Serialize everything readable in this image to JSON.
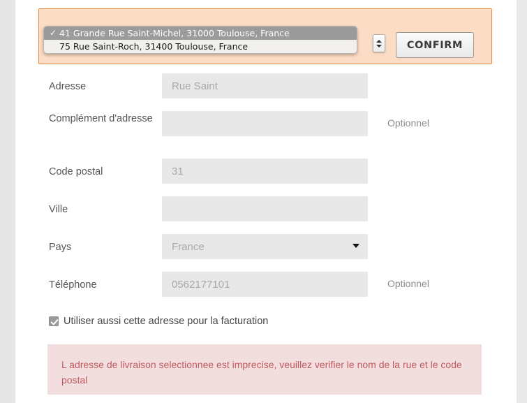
{
  "banner": {
    "select": {
      "name": "shipping-address-select",
      "expanded": true,
      "selected_index": 0,
      "options": [
        {
          "label": "41 Grande Rue Saint-Michel, 31000 Toulouse, France",
          "checkmark": "✓"
        },
        {
          "label": "75 Rue Saint-Roch, 31400 Toulouse, France",
          "checkmark": "✓"
        }
      ]
    },
    "confirm_label": "CONFIRM",
    "background_color": "#fcdcc4",
    "border_color": "#e08a4e"
  },
  "form": {
    "rows": [
      {
        "label": "Adresse",
        "value": "",
        "placeholder": "Rue Saint",
        "optional": "",
        "type": "text"
      },
      {
        "label": "Complément d'adresse",
        "value": "",
        "placeholder": "",
        "optional": "Optionnel",
        "type": "text"
      },
      {
        "label": "Code postal",
        "value": "",
        "placeholder": "31",
        "optional": "",
        "type": "text"
      },
      {
        "label": "Ville",
        "value": "",
        "placeholder": "",
        "optional": "",
        "type": "text"
      },
      {
        "label": "Pays",
        "value": "",
        "placeholder": "France",
        "optional": "",
        "type": "select"
      },
      {
        "label": "Téléphone",
        "value": "",
        "placeholder": "0562177101",
        "optional": "Optionnel",
        "type": "text"
      }
    ],
    "billing_checkbox": {
      "label": "Utiliser aussi cette adresse pour la facturation",
      "checked": true
    }
  },
  "error": {
    "text": "L adresse de livraison selectionnee est imprecise, veuillez verifier le nom de la rue et le code postal",
    "background_color": "#f2dede",
    "text_color": "#bf5a5e"
  }
}
